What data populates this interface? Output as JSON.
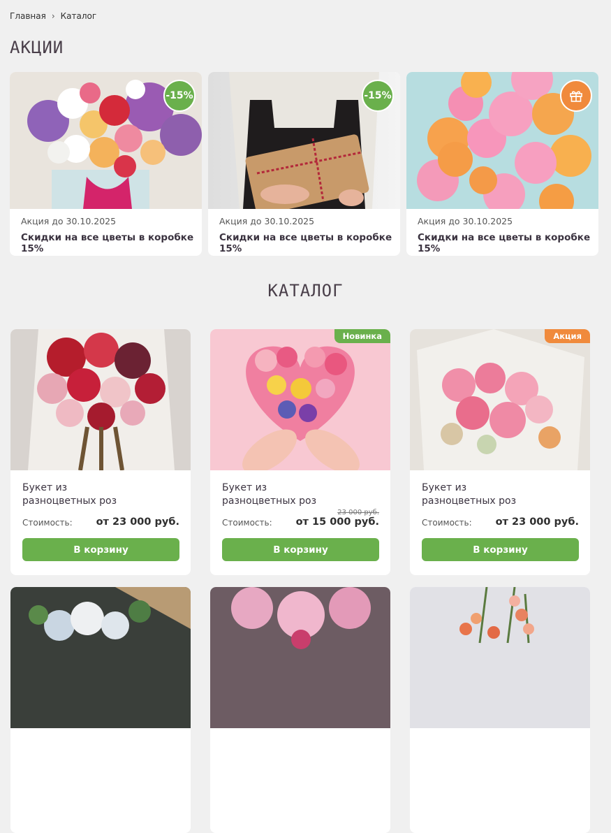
{
  "breadcrumb": {
    "home": "Главная",
    "separator": "›",
    "current": "Каталог"
  },
  "promos": {
    "title": "АКЦИИ",
    "items": [
      {
        "badge": "-15%",
        "date": "Акция до 30.10.2025",
        "text": "Скидки на все цветы в коробке 15%"
      },
      {
        "badge": "-15%",
        "date": "Акция до 30.10.2025",
        "text": "Скидки на все цветы в коробке 15%"
      },
      {
        "badge_icon": "gift-icon",
        "date": "Акция до 30.10.2025",
        "text": "Скидки на все цветы в коробке 15%"
      }
    ]
  },
  "catalog": {
    "title": "КАТАЛОГ",
    "items": [
      {
        "name": "Букет из разноцветных роз",
        "price_label": "Стоимость:",
        "price": "от 23 000 руб.",
        "button": "В корзину"
      },
      {
        "tag": "Новинка",
        "name": "Букет из разноцветных роз",
        "price_label": "Стоимость:",
        "old_price": "23 000 руб.",
        "price": "от 15 000 руб.",
        "button": "В корзину"
      },
      {
        "tag": "Акция",
        "name": "Букет из разноцветных роз",
        "price_label": "Стоимость:",
        "price": "от 23 000 руб.",
        "button": "В корзину"
      }
    ]
  },
  "colors": {
    "accent_green": "#6ab04c",
    "accent_orange": "#f08a3c",
    "background": "#f0f0f0"
  }
}
